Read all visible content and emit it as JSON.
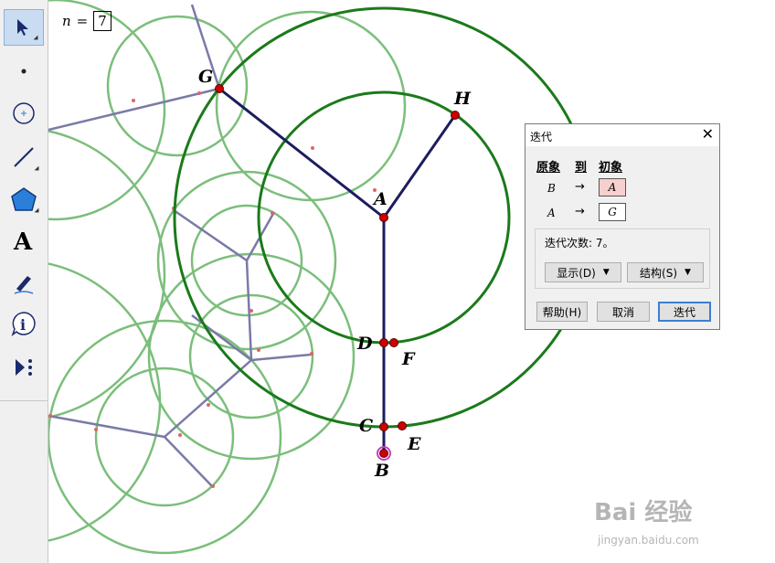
{
  "parameter": {
    "name": "n",
    "eq": "=",
    "value": "7"
  },
  "points": {
    "A": "A",
    "B": "B",
    "C": "C",
    "D": "D",
    "E": "E",
    "F": "F",
    "G": "G",
    "H": "H"
  },
  "dialog": {
    "title": "迭代",
    "close_label": "✕",
    "headers": {
      "preimage": "原象",
      "to": "到",
      "image": "初象"
    },
    "mappings": [
      {
        "source": "B",
        "arrow": "→",
        "target": "A",
        "highlight": true
      },
      {
        "source": "A",
        "arrow": "→",
        "target": "G",
        "highlight": false
      }
    ],
    "iteration_text": "迭代次数: 7。",
    "display_label": "显示(D)",
    "structure_label": "结构(S)",
    "help_label": "帮助(H)",
    "cancel_label": "取消",
    "iterate_label": "迭代"
  },
  "watermark": {
    "main": "Bai 经验",
    "sub": "jingyan.baidu.com"
  },
  "colors": {
    "tree_line": "#1c1c5e",
    "faded_line": "#7a7aa8",
    "main_circle": "#1a7a1a",
    "faded_circle": "#6db86d",
    "point": "#cc0000"
  }
}
